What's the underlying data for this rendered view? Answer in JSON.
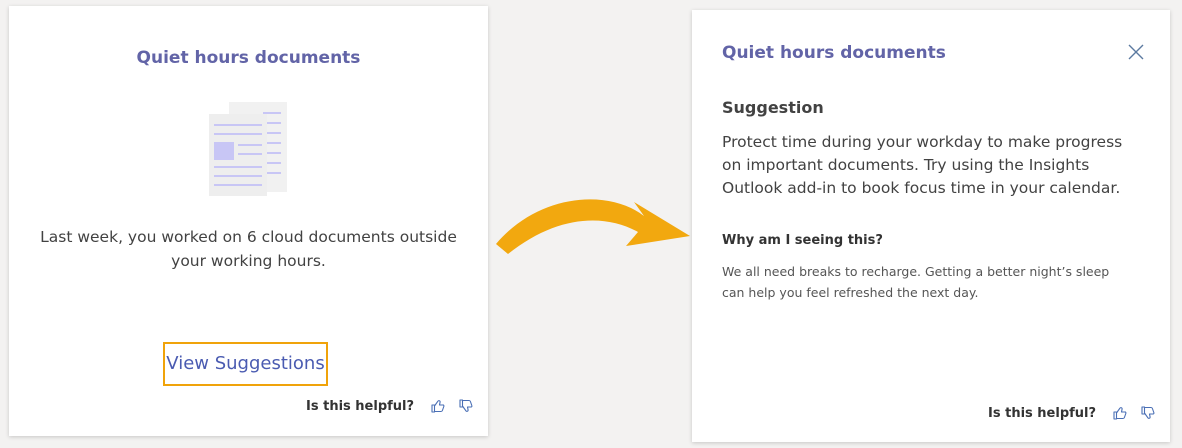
{
  "summary_card": {
    "title": "Quiet hours documents",
    "body": "Last week, you worked on 6 cloud documents outside your working hours.",
    "link_label": "View Suggestions",
    "feedback_label": "Is this helpful?"
  },
  "detail_card": {
    "title": "Quiet hours documents",
    "suggestion_heading": "Suggestion",
    "suggestion_body": "Protect time during your workday to make progress on important documents. Try using the Insights Outlook add-in to book focus time in your calendar.",
    "why_heading": "Why am I seeing this?",
    "why_body": "We all need breaks to recharge. Getting a better night’s sleep can help you feel refreshed the next day.",
    "feedback_label": "Is this helpful?"
  },
  "icons": {
    "documents": "documents-illustration",
    "close": "close-icon",
    "thumbs_up": "thumbs-up-icon",
    "thumbs_down": "thumbs-down-icon",
    "arrow": "curved-arrow"
  },
  "colors": {
    "title": "#6264a7",
    "link": "#4a5bb1",
    "highlight": "#f0a30a",
    "arrow": "#f2a80f",
    "illustration": "#c8c6f5",
    "close": "#5b7aa0"
  }
}
